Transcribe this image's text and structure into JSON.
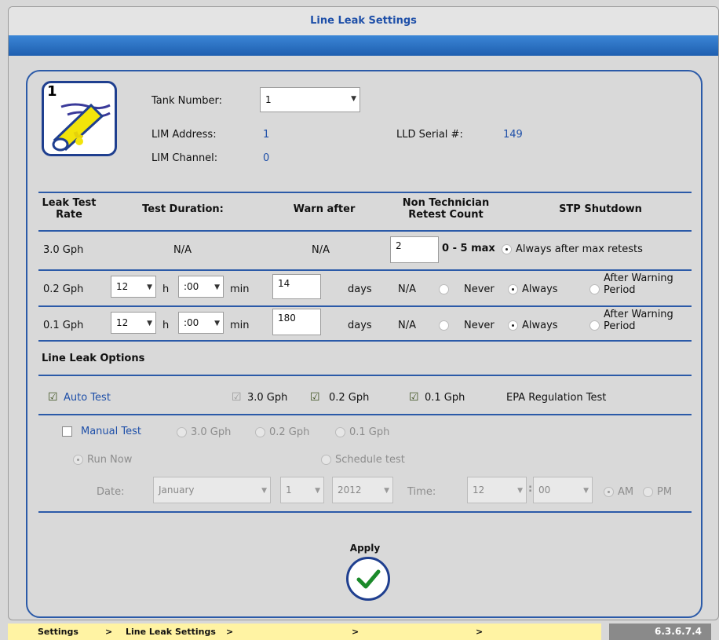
{
  "header": {
    "title": "Line Leak Settings"
  },
  "tank": {
    "icon_number": "1",
    "tank_number_label": "Tank Number:",
    "tank_number_value": "1",
    "lim_address_label": "LIM Address:",
    "lim_address_value": "1",
    "lim_channel_label": "LIM Channel:",
    "lim_channel_value": "0",
    "lld_serial_label": "LLD Serial #:",
    "lld_serial_value": "149"
  },
  "table": {
    "headers": {
      "rate": "Leak Test\nRate",
      "duration": "Test Duration:",
      "warn": "Warn after",
      "retest": "Non Technician\nRetest Count",
      "stp": "STP Shutdown"
    },
    "row1": {
      "rate": "3.0 Gph",
      "duration": "N/A",
      "warn": "N/A",
      "retest_value": "2",
      "retest_max": "0 - 5 max",
      "stp_option": "Always after max retests"
    },
    "row2": {
      "rate": "0.2 Gph",
      "hours": "12",
      "h_label": "h",
      "minutes": ":00",
      "min_label": "min",
      "warn_value": "14",
      "days_label": "days",
      "retest": "N/A",
      "never": "Never",
      "always": "Always",
      "after_warning": "After Warning\nPeriod"
    },
    "row3": {
      "rate": "0.1 Gph",
      "hours": "12",
      "h_label": "h",
      "minutes": ":00",
      "min_label": "min",
      "warn_value": "180",
      "days_label": "days",
      "retest": "N/A",
      "never": "Never",
      "always": "Always",
      "after_warning": "After Warning\nPeriod"
    }
  },
  "options": {
    "title": "Line Leak Options",
    "auto_test": "Auto Test",
    "auto_30": "3.0 Gph",
    "auto_02": "0.2 Gph",
    "auto_01": "0.1 Gph",
    "epa": "EPA Regulation Test",
    "manual_test": "Manual Test",
    "manual_30": "3.0 Gph",
    "manual_02": "0.2 Gph",
    "manual_01": "0.1 Gph",
    "run_now": "Run Now",
    "schedule": "Schedule test",
    "date_label": "Date:",
    "month": "January",
    "day": "1",
    "year": "2012",
    "time_label": "Time:",
    "hour": "12",
    "colon": ":",
    "minute": "00",
    "am": "AM",
    "pm": "PM"
  },
  "apply": {
    "label": "Apply"
  },
  "breadcrumb": {
    "item1": "Settings",
    "sep": ">",
    "item2": "Line Leak Settings"
  },
  "version": "6.3.6.7.4",
  "colors": {
    "accent": "#1e4fa8",
    "bar": "#2b6fc4",
    "breadcrumb_bg": "#fff3a3"
  }
}
